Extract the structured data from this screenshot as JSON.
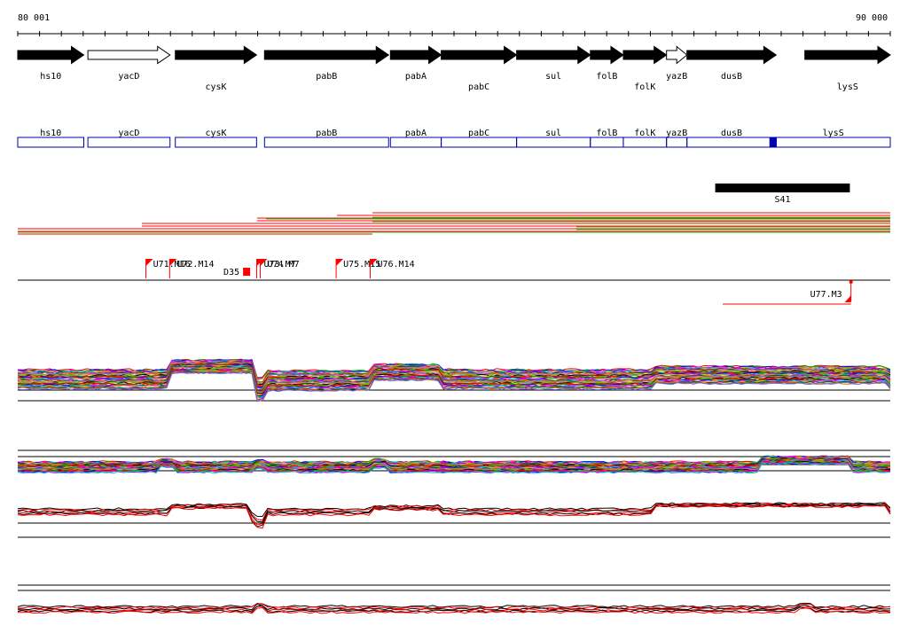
{
  "ruler": {
    "start_label": "80 001",
    "end_label": "90 000"
  },
  "genes": [
    {
      "name": "hs10",
      "start": 80001,
      "end": 80758,
      "strand": "+",
      "filled": true,
      "label_row": 0
    },
    {
      "name": "yacD",
      "start": 80805,
      "end": 81746,
      "strand": "+",
      "filled": false,
      "label_row": 0
    },
    {
      "name": "cysK",
      "start": 81807,
      "end": 82738,
      "strand": "+",
      "filled": true,
      "label_row": 1
    },
    {
      "name": "pabB",
      "start": 82829,
      "end": 84251,
      "strand": "+",
      "filled": true,
      "label_row": 0
    },
    {
      "name": "pabA",
      "start": 84272,
      "end": 84854,
      "strand": "+",
      "filled": true,
      "label_row": 0
    },
    {
      "name": "pabC",
      "start": 84854,
      "end": 85718,
      "strand": "+",
      "filled": true,
      "label_row": 1
    },
    {
      "name": "sul",
      "start": 85718,
      "end": 86563,
      "strand": "+",
      "filled": true,
      "label_row": 0
    },
    {
      "name": "folB",
      "start": 86563,
      "end": 86941,
      "strand": "+",
      "filled": true,
      "label_row": 0
    },
    {
      "name": "folK",
      "start": 86941,
      "end": 87436,
      "strand": "+",
      "filled": true,
      "label_row": 1
    },
    {
      "name": "yazB",
      "start": 87436,
      "end": 87670,
      "strand": "+",
      "filled": false,
      "label_row": 0
    },
    {
      "name": "dusB",
      "start": 87670,
      "end": 88693,
      "strand": "+",
      "filled": true,
      "label_row": 0
    },
    {
      "name": "lysS",
      "start": 89021,
      "end": 90000,
      "strand": "+",
      "filled": true,
      "label_row": 1
    }
  ],
  "blue_boxes": [
    {
      "name": "hs10",
      "start": 80001,
      "end": 80758
    },
    {
      "name": "yacD",
      "start": 80805,
      "end": 81746
    },
    {
      "name": "cysK",
      "start": 81807,
      "end": 82738
    },
    {
      "name": "pabB",
      "start": 82829,
      "end": 84251
    },
    {
      "name": "pabA",
      "start": 84272,
      "end": 84854
    },
    {
      "name": "pabC",
      "start": 84854,
      "end": 85718
    },
    {
      "name": "sul",
      "start": 85718,
      "end": 86563
    },
    {
      "name": "folB",
      "start": 86563,
      "end": 86941
    },
    {
      "name": "folK",
      "start": 86941,
      "end": 87436
    },
    {
      "name": "yazB",
      "start": 87436,
      "end": 87670
    },
    {
      "name": "dusB",
      "start": 87670,
      "end": 88693
    },
    {
      "name": "lysS",
      "start": 88693,
      "end": 90000
    }
  ],
  "blue_marker": {
    "start": 88615,
    "end": 88693
  },
  "black_bar": {
    "label": "S41",
    "start": 87994,
    "end": 89537
  },
  "primer_labels": [
    {
      "label": "U71.M16",
      "pos": 81470
    },
    {
      "label": "U72.M14",
      "pos": 81742
    },
    {
      "label": "D35",
      "pos": 82644
    },
    {
      "label": "U73.M7",
      "pos": 82740
    },
    {
      "label": "U74.M7",
      "pos": 82780
    },
    {
      "label": "U75.M15",
      "pos": 83650
    },
    {
      "label": "U76.M14",
      "pos": 84040
    },
    {
      "label": "U77.M3",
      "pos": 89550
    }
  ],
  "colors": {
    "gene_fill": "#000000",
    "blue_box": "#0000aa",
    "red": "#ff0000",
    "green": "#22cc22"
  }
}
